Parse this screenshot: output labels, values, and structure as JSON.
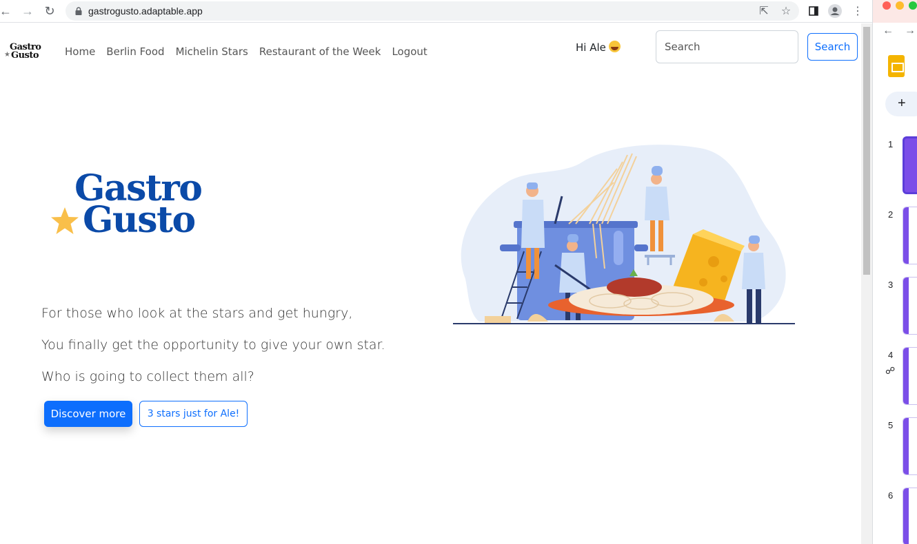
{
  "browser": {
    "url": "gastrogusto.adaptable.app"
  },
  "navbar": {
    "logo_line1": "Gastro",
    "logo_line2": "Gusto",
    "links": [
      "Home",
      "Berlin Food",
      "Michelin Stars",
      "Restaurant of the Week",
      "Logout"
    ],
    "greeting": "Hi Ale",
    "search_placeholder": "Search",
    "search_button": "Search"
  },
  "hero": {
    "logo_line1": "Gastro",
    "logo_line2": "Gusto",
    "lines": [
      "For those who look at the stars and get hungry,",
      "You finally get the opportunity to give your own star.",
      "Who is going to collect them all?"
    ],
    "primary_button": "Discover more",
    "secondary_button": "3 stars just for Ale!"
  },
  "side_panel": {
    "slide_numbers": [
      "1",
      "2",
      "3",
      "4",
      "5",
      "6"
    ]
  },
  "colors": {
    "brand_blue": "#0b4aa8",
    "primary": "#0d6efd",
    "star": "#f9bf4a"
  }
}
